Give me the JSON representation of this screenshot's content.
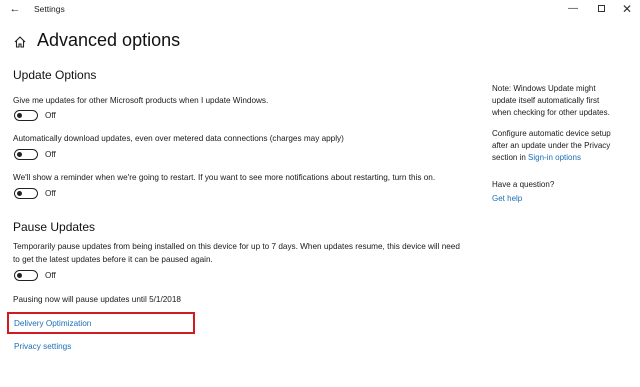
{
  "window": {
    "title": "Settings",
    "minimize_glyph": "—",
    "close_glyph": "✕"
  },
  "page": {
    "title": "Advanced options"
  },
  "update_options": {
    "heading": "Update Options",
    "items": [
      {
        "description": "Give me updates for other Microsoft products when I update Windows.",
        "state": "Off"
      },
      {
        "description": "Automatically download updates, even over metered data connections (charges may apply)",
        "state": "Off"
      },
      {
        "description": "We'll show a reminder when we're going to restart. If you want to see more notifications about restarting, turn this on.",
        "state": "Off"
      }
    ]
  },
  "pause_updates": {
    "heading": "Pause Updates",
    "description_line1": "Temporarily pause updates from being installed on this device for up to 7 days. When updates resume, this device will need",
    "description_line2": "to get the latest updates before it can be paused again.",
    "state": "Off",
    "status": "Pausing now will pause updates until 5/1/2018"
  },
  "links": {
    "delivery_optimization": "Delivery Optimization",
    "privacy_settings": "Privacy settings"
  },
  "sidebar": {
    "note_lines": [
      "Note: Windows Update might",
      "update itself automatically first",
      "when checking for other updates."
    ],
    "configure_lines": [
      "Configure automatic device setup",
      "after an update under the Privacy",
      "section in "
    ],
    "signin_link": "Sign-in options",
    "question": "Have a question?",
    "help_link": "Get help"
  },
  "colors": {
    "link": "#1a6fb4",
    "highlight": "#d01c20"
  }
}
